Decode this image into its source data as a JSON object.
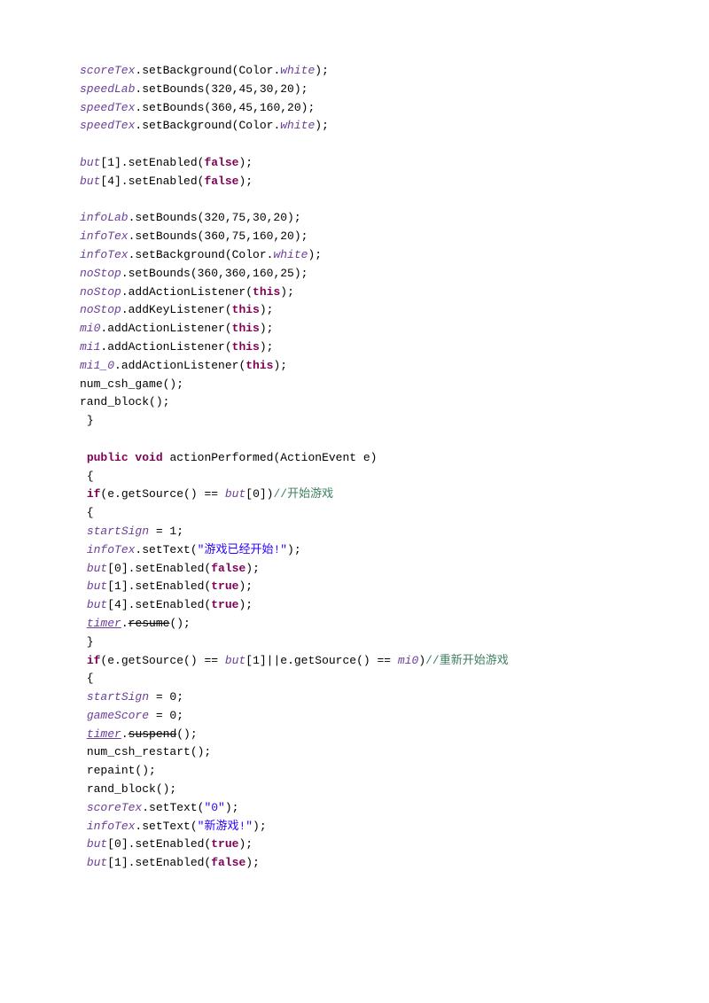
{
  "code": {
    "lines": [
      {
        "indent": 0,
        "segs": [
          {
            "c": "field-italic",
            "t": "scoreTex"
          },
          {
            "c": "dot",
            "t": ".setBackground(Color."
          },
          {
            "c": "field-italic",
            "t": "white"
          },
          {
            "c": "dot",
            "t": ");"
          }
        ]
      },
      {
        "indent": 0,
        "segs": [
          {
            "c": "field-italic",
            "t": "speedLab"
          },
          {
            "c": "dot",
            "t": ".setBounds(320,45,30,20);"
          }
        ]
      },
      {
        "indent": 0,
        "segs": [
          {
            "c": "field-italic",
            "t": "speedTex"
          },
          {
            "c": "dot",
            "t": ".setBounds(360,45,160,20);"
          }
        ]
      },
      {
        "indent": 0,
        "segs": [
          {
            "c": "field-italic",
            "t": "speedTex"
          },
          {
            "c": "dot",
            "t": ".setBackground(Color."
          },
          {
            "c": "field-italic",
            "t": "white"
          },
          {
            "c": "dot",
            "t": ");"
          }
        ]
      },
      {
        "blank": true
      },
      {
        "indent": 0,
        "segs": [
          {
            "c": "field-italic",
            "t": "but"
          },
          {
            "c": "dot",
            "t": "[1].setEnabled("
          },
          {
            "c": "keyword",
            "t": "false"
          },
          {
            "c": "dot",
            "t": ");"
          }
        ]
      },
      {
        "indent": 0,
        "segs": [
          {
            "c": "field-italic",
            "t": "but"
          },
          {
            "c": "dot",
            "t": "[4].setEnabled("
          },
          {
            "c": "keyword",
            "t": "false"
          },
          {
            "c": "dot",
            "t": ");"
          }
        ]
      },
      {
        "blank": true
      },
      {
        "indent": 0,
        "segs": [
          {
            "c": "field-italic",
            "t": "infoLab"
          },
          {
            "c": "dot",
            "t": ".setBounds(320,75,30,20);"
          }
        ]
      },
      {
        "indent": 0,
        "segs": [
          {
            "c": "field-italic",
            "t": "infoTex"
          },
          {
            "c": "dot",
            "t": ".setBounds(360,75,160,20);"
          }
        ]
      },
      {
        "indent": 0,
        "segs": [
          {
            "c": "field-italic",
            "t": "infoTex"
          },
          {
            "c": "dot",
            "t": ".setBackground(Color."
          },
          {
            "c": "field-italic",
            "t": "white"
          },
          {
            "c": "dot",
            "t": ");"
          }
        ]
      },
      {
        "indent": 0,
        "segs": [
          {
            "c": "field-italic",
            "t": "noStop"
          },
          {
            "c": "dot",
            "t": ".setBounds(360,360,160,25);"
          }
        ]
      },
      {
        "indent": 0,
        "segs": [
          {
            "c": "field-italic",
            "t": "noStop"
          },
          {
            "c": "dot",
            "t": ".addActionListener("
          },
          {
            "c": "keyword",
            "t": "this"
          },
          {
            "c": "dot",
            "t": ");"
          }
        ]
      },
      {
        "indent": 0,
        "segs": [
          {
            "c": "field-italic",
            "t": "noStop"
          },
          {
            "c": "dot",
            "t": ".addKeyListener("
          },
          {
            "c": "keyword",
            "t": "this"
          },
          {
            "c": "dot",
            "t": ");"
          }
        ]
      },
      {
        "indent": 0,
        "segs": [
          {
            "c": "field-italic",
            "t": "mi0"
          },
          {
            "c": "dot",
            "t": ".addActionListener("
          },
          {
            "c": "keyword",
            "t": "this"
          },
          {
            "c": "dot",
            "t": ");"
          }
        ]
      },
      {
        "indent": 0,
        "segs": [
          {
            "c": "field-italic",
            "t": "mi1"
          },
          {
            "c": "dot",
            "t": ".addActionListener("
          },
          {
            "c": "keyword",
            "t": "this"
          },
          {
            "c": "dot",
            "t": ");"
          }
        ]
      },
      {
        "indent": 0,
        "segs": [
          {
            "c": "field-italic",
            "t": "mi1_0"
          },
          {
            "c": "dot",
            "t": ".addActionListener("
          },
          {
            "c": "keyword",
            "t": "this"
          },
          {
            "c": "dot",
            "t": ");"
          }
        ]
      },
      {
        "indent": 0,
        "segs": [
          {
            "c": "dot",
            "t": "num_csh_game();"
          }
        ]
      },
      {
        "indent": 0,
        "segs": [
          {
            "c": "dot",
            "t": "rand_block();"
          }
        ]
      },
      {
        "indent": 1,
        "segs": [
          {
            "c": "dot",
            "t": "}"
          }
        ]
      },
      {
        "blank": true
      },
      {
        "indent": 1,
        "segs": [
          {
            "c": "keyword",
            "t": "public void"
          },
          {
            "c": "dot",
            "t": " actionPerformed(ActionEvent e)"
          }
        ]
      },
      {
        "indent": 1,
        "segs": [
          {
            "c": "dot",
            "t": "{"
          }
        ]
      },
      {
        "indent": 0,
        "segs": [
          {
            "c": "dot",
            "t": " "
          },
          {
            "c": "keyword",
            "t": "if"
          },
          {
            "c": "dot",
            "t": "(e.getSource() == "
          },
          {
            "c": "field-italic",
            "t": "but"
          },
          {
            "c": "dot",
            "t": "[0])"
          },
          {
            "c": "comment",
            "t": "//开始游戏"
          }
        ]
      },
      {
        "indent": 0,
        "segs": [
          {
            "c": "dot",
            "t": " {"
          }
        ]
      },
      {
        "indent": 1,
        "segs": [
          {
            "c": "field-italic",
            "t": "startSign"
          },
          {
            "c": "dot",
            "t": " = 1;"
          }
        ]
      },
      {
        "indent": 1,
        "segs": [
          {
            "c": "field-italic",
            "t": "infoTex"
          },
          {
            "c": "dot",
            "t": ".setText("
          },
          {
            "c": "string",
            "t": "\"游戏已经开始!\""
          },
          {
            "c": "dot",
            "t": ");"
          }
        ]
      },
      {
        "indent": 1,
        "segs": [
          {
            "c": "field-italic",
            "t": "but"
          },
          {
            "c": "dot",
            "t": "[0].setEnabled("
          },
          {
            "c": "keyword",
            "t": "false"
          },
          {
            "c": "dot",
            "t": ");"
          }
        ]
      },
      {
        "indent": 1,
        "segs": [
          {
            "c": "field-italic",
            "t": "but"
          },
          {
            "c": "dot",
            "t": "[1].setEnabled("
          },
          {
            "c": "keyword",
            "t": "true"
          },
          {
            "c": "dot",
            "t": ");"
          }
        ]
      },
      {
        "indent": 1,
        "segs": [
          {
            "c": "field-italic",
            "t": "but"
          },
          {
            "c": "dot",
            "t": "[4].setEnabled("
          },
          {
            "c": "keyword",
            "t": "true"
          },
          {
            "c": "dot",
            "t": ");"
          }
        ]
      },
      {
        "indent": 1,
        "segs": [
          {
            "c": "field-italic underline",
            "t": "timer"
          },
          {
            "c": "dot",
            "t": "."
          },
          {
            "c": "strike",
            "t": "resume"
          },
          {
            "c": "dot",
            "t": "();"
          }
        ]
      },
      {
        "indent": 0,
        "segs": [
          {
            "c": "dot",
            "t": " }"
          }
        ]
      },
      {
        "indent": 0,
        "segs": [
          {
            "c": "dot",
            "t": " "
          },
          {
            "c": "keyword",
            "t": "if"
          },
          {
            "c": "dot",
            "t": "(e.getSource() == "
          },
          {
            "c": "field-italic",
            "t": "but"
          },
          {
            "c": "dot",
            "t": "[1]||e.getSource() == "
          },
          {
            "c": "field-italic",
            "t": "mi0"
          },
          {
            "c": "dot",
            "t": ")"
          },
          {
            "c": "comment",
            "t": "//重新开始游戏"
          }
        ]
      },
      {
        "indent": 0,
        "segs": [
          {
            "c": "dot",
            "t": " {"
          }
        ]
      },
      {
        "indent": 1,
        "segs": [
          {
            "c": "field-italic",
            "t": "startSign"
          },
          {
            "c": "dot",
            "t": " = 0;"
          }
        ]
      },
      {
        "indent": 1,
        "segs": [
          {
            "c": "field-italic",
            "t": "gameScore"
          },
          {
            "c": "dot",
            "t": " = 0;"
          }
        ]
      },
      {
        "indent": 1,
        "segs": [
          {
            "c": "field-italic underline",
            "t": "timer"
          },
          {
            "c": "dot",
            "t": "."
          },
          {
            "c": "strike",
            "t": "suspend"
          },
          {
            "c": "dot",
            "t": "();"
          }
        ]
      },
      {
        "indent": 1,
        "segs": [
          {
            "c": "dot",
            "t": "num_csh_restart();"
          }
        ]
      },
      {
        "indent": 1,
        "segs": [
          {
            "c": "dot",
            "t": "repaint();"
          }
        ]
      },
      {
        "indent": 1,
        "segs": [
          {
            "c": "dot",
            "t": "rand_block();"
          }
        ]
      },
      {
        "indent": 1,
        "segs": [
          {
            "c": "field-italic",
            "t": "scoreTex"
          },
          {
            "c": "dot",
            "t": ".setText("
          },
          {
            "c": "string",
            "t": "\"0\""
          },
          {
            "c": "dot",
            "t": ");"
          }
        ]
      },
      {
        "indent": 1,
        "segs": [
          {
            "c": "field-italic",
            "t": "infoTex"
          },
          {
            "c": "dot",
            "t": ".setText("
          },
          {
            "c": "string",
            "t": "\"新游戏!\""
          },
          {
            "c": "dot",
            "t": ");"
          }
        ]
      },
      {
        "indent": 1,
        "segs": [
          {
            "c": "field-italic",
            "t": "but"
          },
          {
            "c": "dot",
            "t": "[0].setEnabled("
          },
          {
            "c": "keyword",
            "t": "true"
          },
          {
            "c": "dot",
            "t": ");"
          }
        ]
      },
      {
        "indent": 1,
        "segs": [
          {
            "c": "field-italic",
            "t": "but"
          },
          {
            "c": "dot",
            "t": "[1].setEnabled("
          },
          {
            "c": "keyword",
            "t": "false"
          },
          {
            "c": "dot",
            "t": ");"
          }
        ]
      }
    ]
  }
}
